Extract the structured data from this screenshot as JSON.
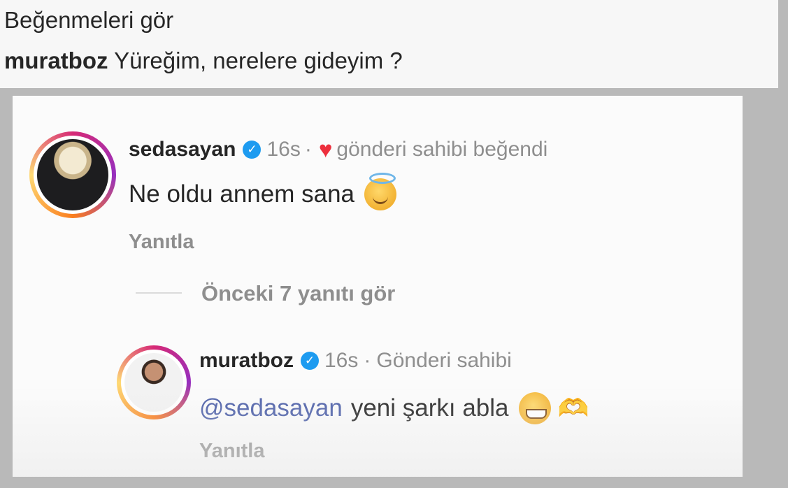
{
  "header": {
    "view_likes": "Beğenmeleri gör",
    "caption_user": "muratboz",
    "caption_text": "Yüreğim, nerelere gideyim ?"
  },
  "comments": [
    {
      "username": "sedasayan",
      "verified": true,
      "time": "16s",
      "separator": "·",
      "liked_by_author": "gönderi sahibi beğendi",
      "text": "Ne oldu annem sana",
      "emoji": "smiling-face-with-halo",
      "reply_label": "Yanıtla"
    }
  ],
  "view_previous_replies": "Önceki 7 yanıtı gör",
  "replies": [
    {
      "username": "muratboz",
      "verified": true,
      "time": "16s",
      "separator": "·",
      "author_label": "Gönderi sahibi",
      "mention": "@sedasayan",
      "text": "yeni şarkı abla",
      "emojis": [
        "grinning-face",
        "heart-hands"
      ],
      "reply_label": "Yanıtla"
    }
  ],
  "colors": {
    "mention": "#4c5fa8",
    "verified": "#1d9bf0",
    "heart": "#ed2f3d",
    "meta": "#8e8e8e"
  }
}
